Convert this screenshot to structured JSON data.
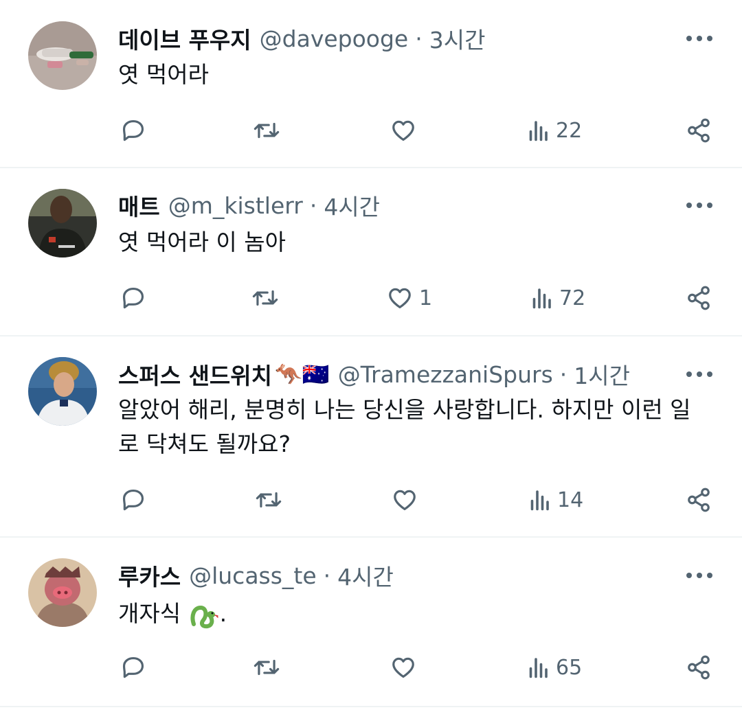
{
  "tweets": [
    {
      "name": "데이브 푸우지",
      "badges": "",
      "handle": "@davepooge",
      "separator": "·",
      "time": "3시간",
      "text": "엿 먹어라",
      "emoji": "",
      "likes": "",
      "views": "22"
    },
    {
      "name": "매트",
      "badges": "",
      "handle": "@m_kistlerr",
      "separator": "·",
      "time": "4시간",
      "text": "엿 먹어라 이 놈아",
      "emoji": "",
      "likes": "1",
      "views": "72"
    },
    {
      "name": "스퍼스 샌드위치",
      "badges": "🦘🇦🇺",
      "handle": "@TramezzaniSpurs",
      "separator": "·",
      "time": "1시간",
      "text": "알았어 해리, 분명히 나는 당신을 사랑합니다. 하지만 이런 일로 닥쳐도 될까요?",
      "emoji": "",
      "likes": "",
      "views": "14"
    },
    {
      "name": "루카스",
      "badges": "",
      "handle": "@lucass_te",
      "separator": "·",
      "time": "4시간",
      "text": "개자식",
      "emoji": "snake-emoji",
      "text_suffix": ".",
      "likes": "",
      "views": "65"
    }
  ],
  "icons": {
    "reply": "reply-icon",
    "retweet": "retweet-icon",
    "like": "heart-icon",
    "views": "views-icon",
    "share": "share-icon",
    "more": "more-icon"
  },
  "colors": {
    "text": "#0f1419",
    "secondary": "#536471",
    "divider": "#eff3f4",
    "snake": "#6ab04c"
  }
}
